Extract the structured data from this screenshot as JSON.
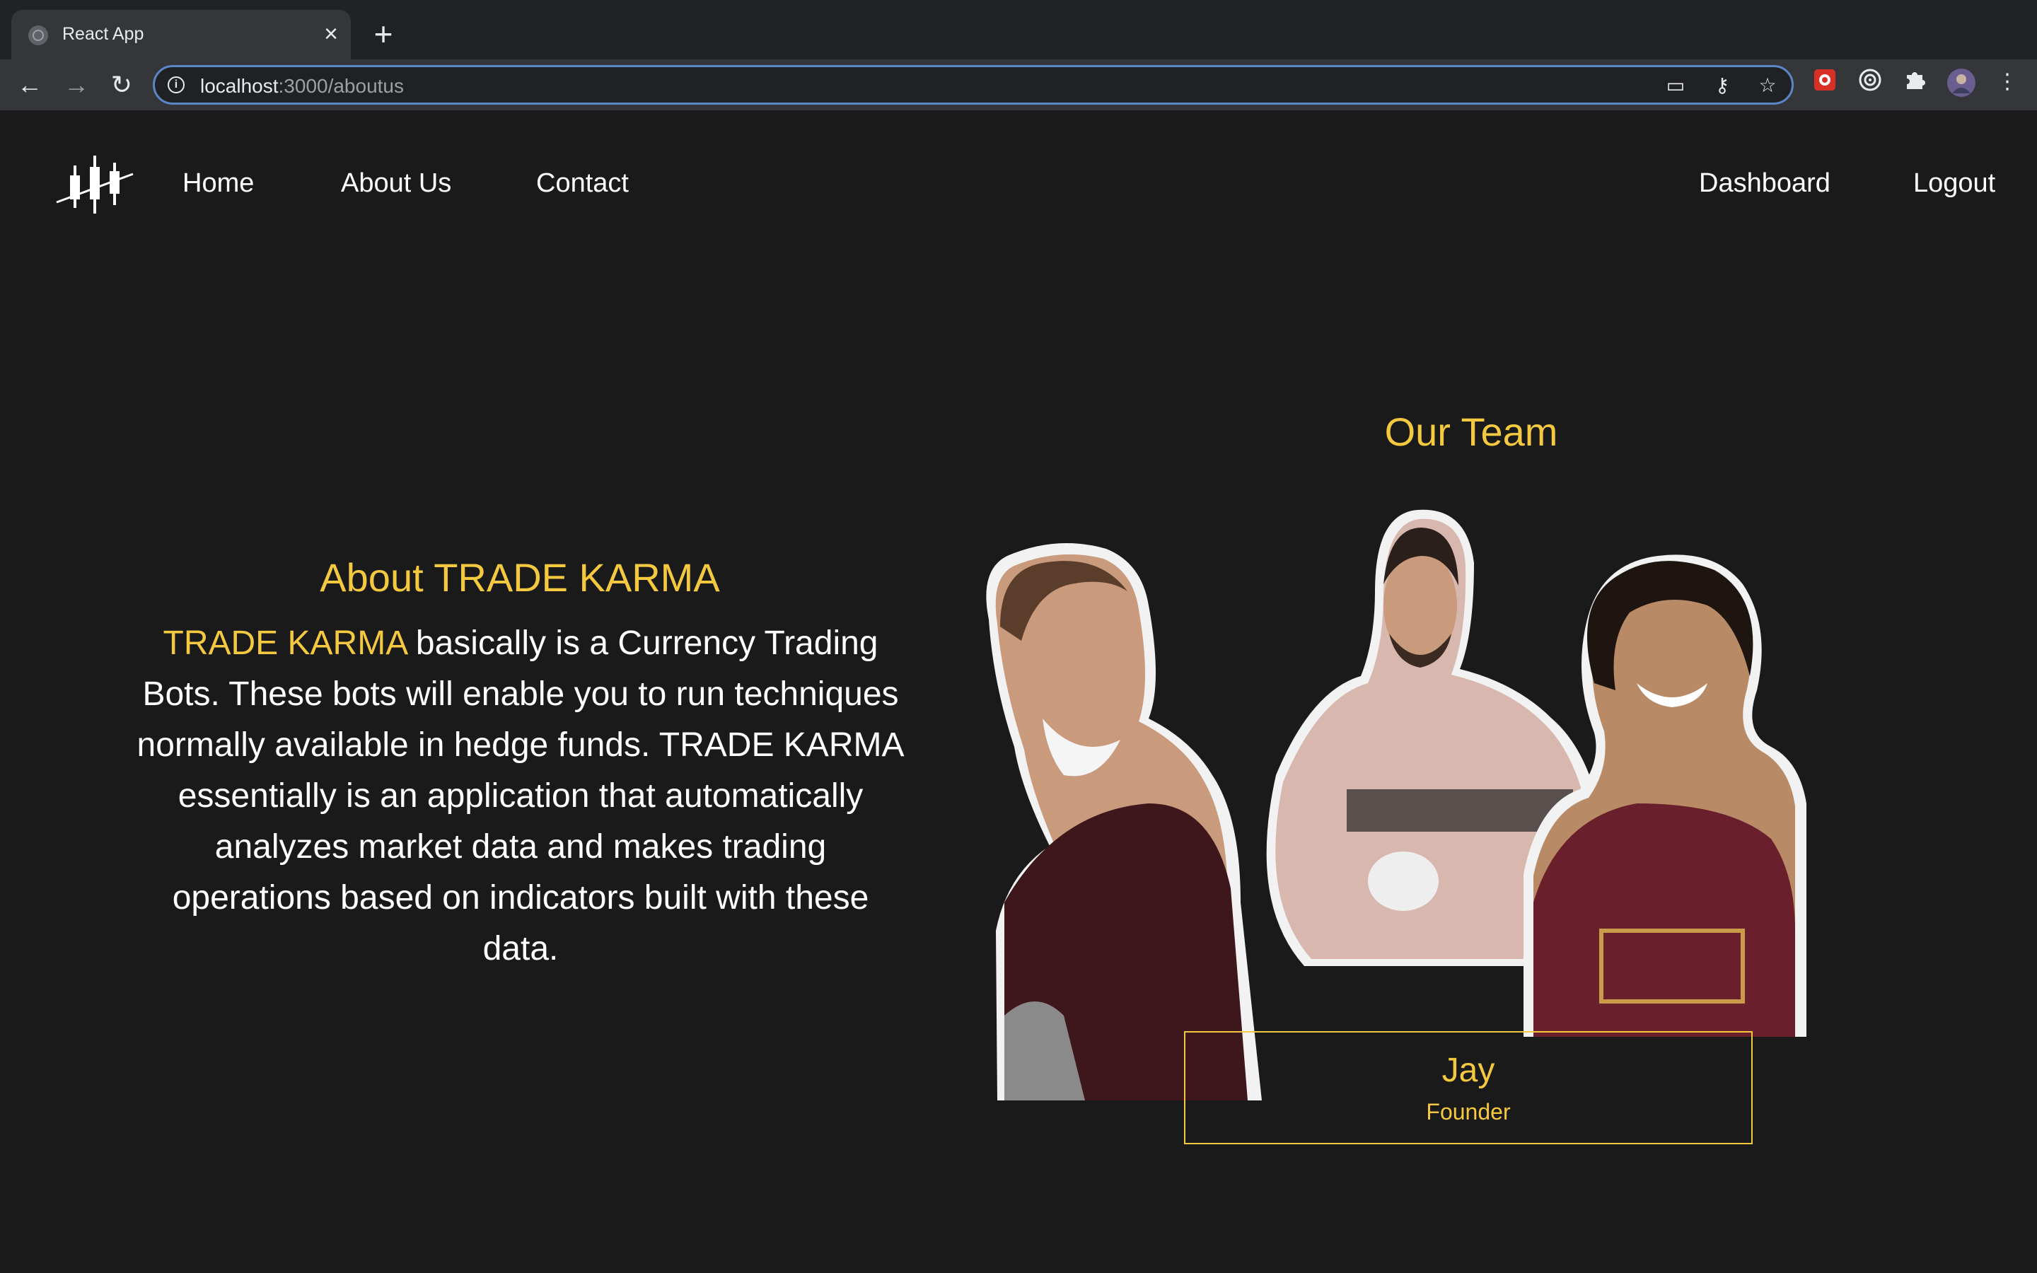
{
  "browser": {
    "tab_title": "React App",
    "url_host": "localhost",
    "url_path": ":3000/aboutus"
  },
  "nav": {
    "left": [
      "Home",
      "About Us",
      "Contact"
    ],
    "right": [
      "Dashboard",
      "Logout"
    ]
  },
  "about": {
    "title": "About TRADE KARMA",
    "highlight": "TRADE KARMA",
    "body": " basically is a Currency Trading Bots. These bots will enable you to run techniques normally available in hedge funds. TRADE KARMA essentially is an application that automatically analyzes market data and makes trading operations based on indicators built with these data."
  },
  "team": {
    "title": "Our Team",
    "photo": "team-photo",
    "member": {
      "name": "Jay",
      "role": "Founder"
    }
  },
  "colors": {
    "accent": "#f5c93f",
    "background": "#1a1a1b",
    "text": "#ffffff"
  }
}
